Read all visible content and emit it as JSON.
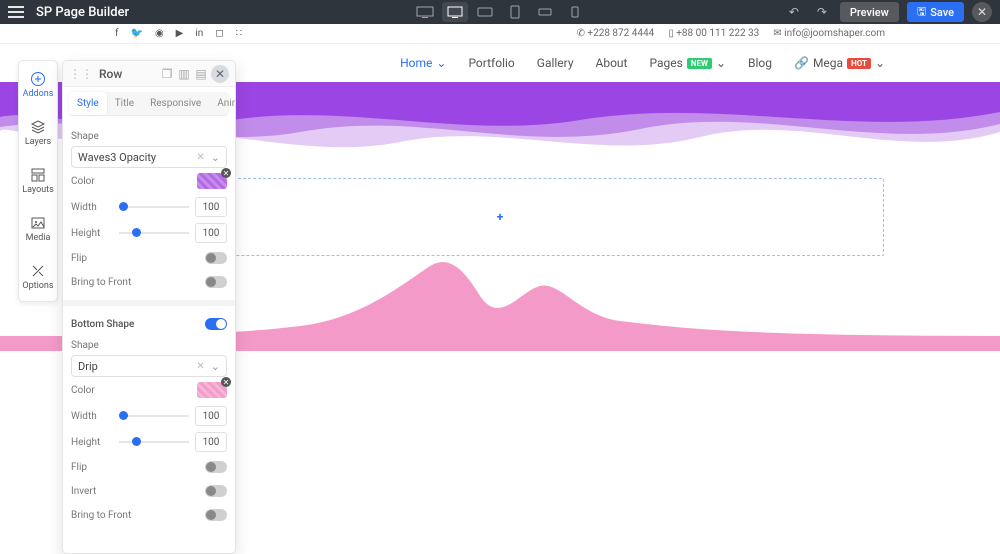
{
  "topbar": {
    "title": "SP Page Builder",
    "preview": "Preview",
    "save": "Save"
  },
  "devices": [
    "desktop-wide",
    "desktop",
    "tablet-landscape",
    "tablet",
    "phone-landscape",
    "phone"
  ],
  "info": {
    "phone1": "+228 872 4444",
    "phone2": "+88 00 111 222 33",
    "email": "info@joomshaper.com"
  },
  "nav": {
    "home": "Home",
    "portfolio": "Portfolio",
    "gallery": "Gallery",
    "about": "About",
    "pages": "Pages",
    "pages_badge": "NEW",
    "blog": "Blog",
    "mega": "Mega",
    "mega_badge": "HOT"
  },
  "tools": {
    "addons": "Addons",
    "layers": "Layers",
    "layouts": "Layouts",
    "media": "Media",
    "options": "Options"
  },
  "panel": {
    "title": "Row",
    "tabs": {
      "style": "Style",
      "title": "Title",
      "responsive": "Responsive",
      "animation": "Animation"
    },
    "top": {
      "shape_label": "Shape",
      "shape_value": "Waves3 Opacity",
      "color_label": "Color",
      "width_label": "Width",
      "width_value": "100",
      "height_label": "Height",
      "height_value": "100",
      "flip": "Flip",
      "bring_front": "Bring to Front"
    },
    "bottom": {
      "section": "Bottom Shape",
      "shape_label": "Shape",
      "shape_value": "Drip",
      "color_label": "Color",
      "width_label": "Width",
      "width_value": "100",
      "height_label": "Height",
      "height_value": "100",
      "flip": "Flip",
      "invert": "Invert",
      "bring_front": "Bring to Front"
    }
  }
}
